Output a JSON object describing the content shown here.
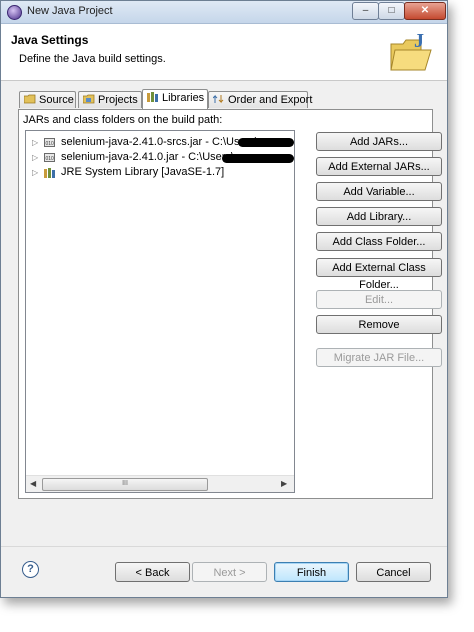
{
  "window": {
    "title": "New Java Project"
  },
  "banner": {
    "title": "Java Settings",
    "description": "Define the Java build settings."
  },
  "tabs": [
    {
      "label": "Source",
      "active": false
    },
    {
      "label": "Projects",
      "active": false
    },
    {
      "label": "Libraries",
      "active": true
    },
    {
      "label": "Order and Export",
      "active": false
    }
  ],
  "libraries": {
    "heading": "JARs and class folders on the build path:",
    "items": [
      {
        "label": "selenium-java-2.41.0-srcs.jar - C:\\Users\\a",
        "icon": "jar-icon"
      },
      {
        "label": "selenium-java-2.41.0.jar - C:\\Users\\a",
        "icon": "jar-icon"
      },
      {
        "label": "JRE System Library [JavaSE-1.7]",
        "icon": "library-icon"
      }
    ]
  },
  "buttons": {
    "add_jars": "Add JARs...",
    "add_external_jars": "Add External JARs...",
    "add_variable": "Add Variable...",
    "add_library": "Add Library...",
    "add_class_folder": "Add Class Folder...",
    "add_external_class_folder": "Add External Class Folder...",
    "edit": "Edit...",
    "remove": "Remove",
    "migrate_jar": "Migrate JAR File..."
  },
  "footer": {
    "back": "< Back",
    "next": "Next >",
    "finish": "Finish",
    "cancel": "Cancel"
  },
  "scrollbar": {
    "thumb_grip": "III"
  }
}
